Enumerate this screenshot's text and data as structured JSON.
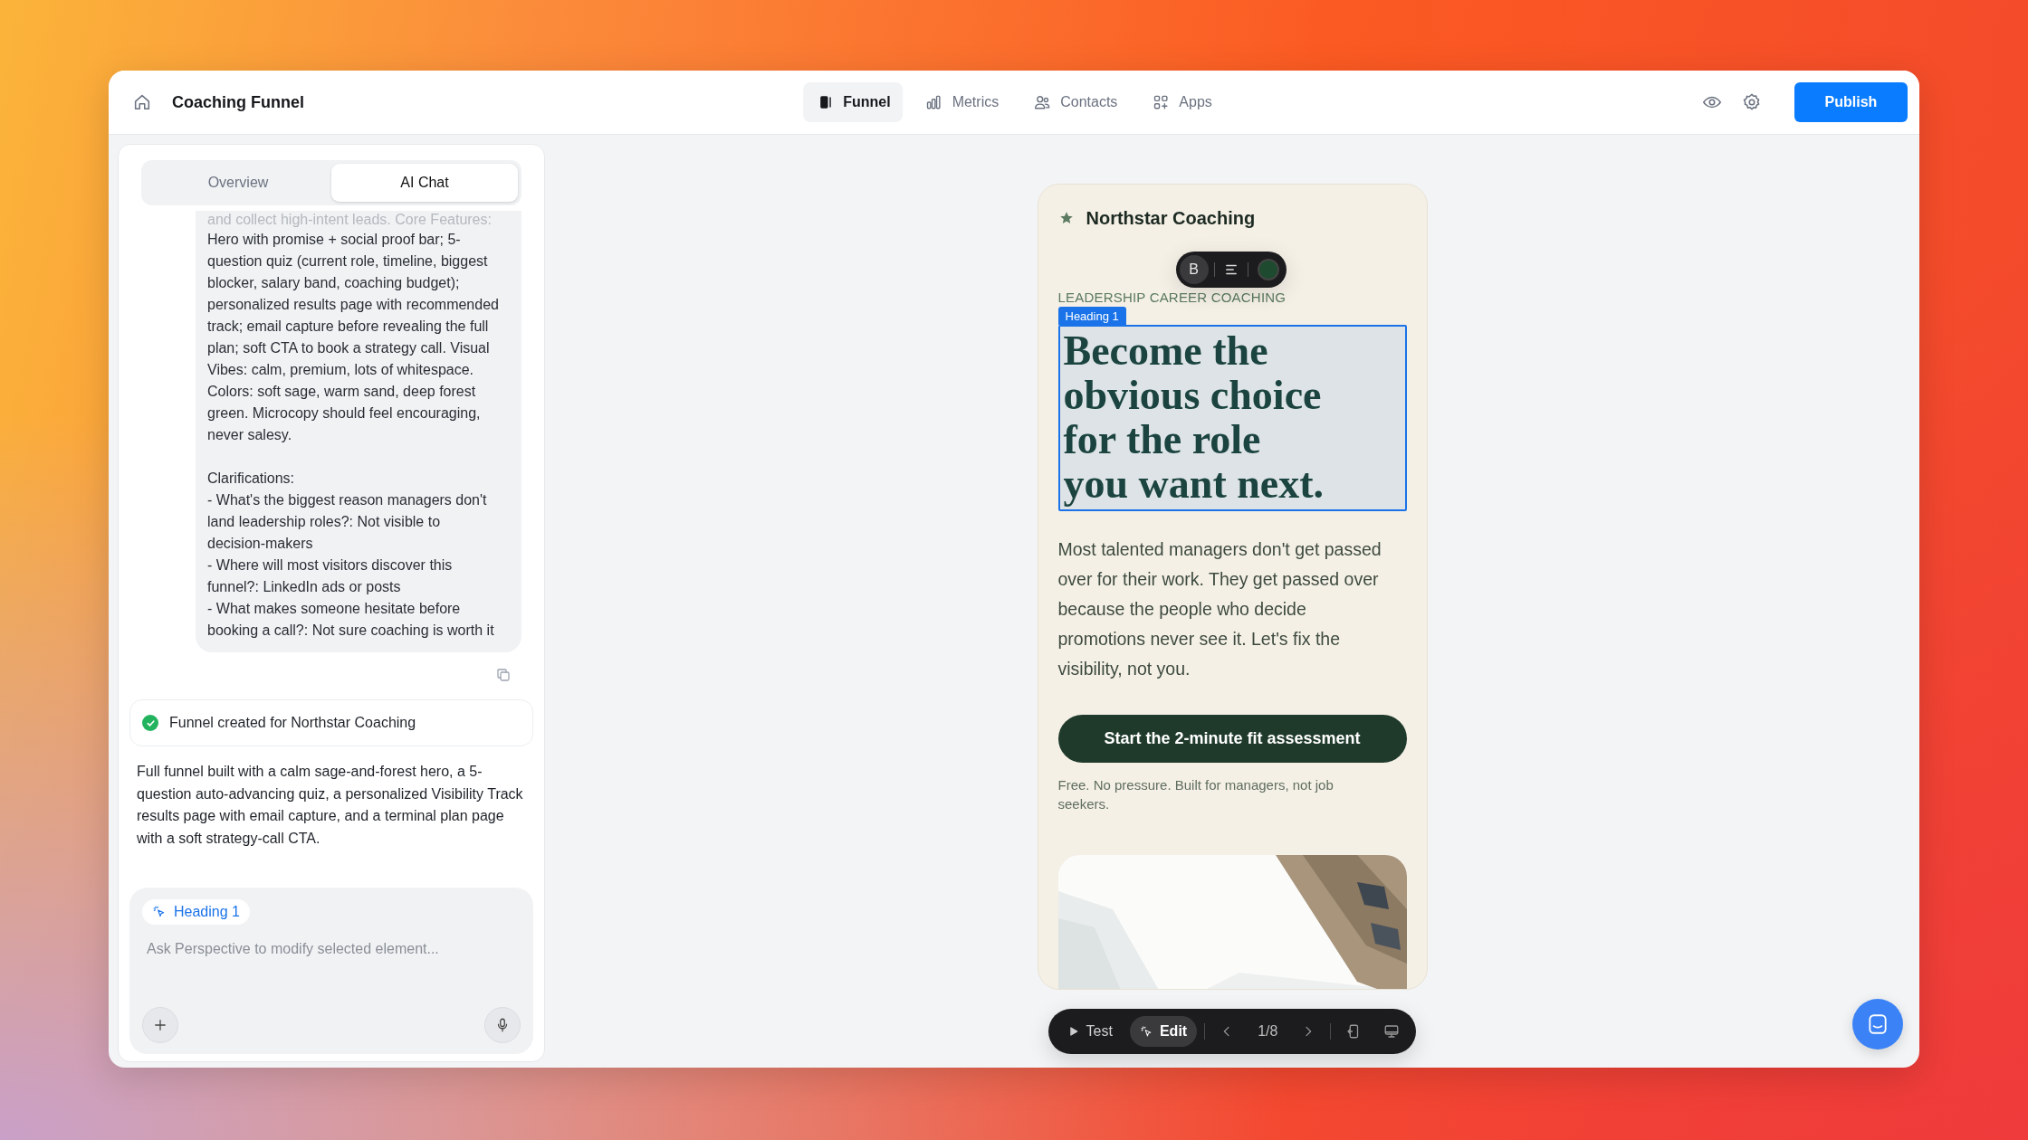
{
  "topbar": {
    "title": "Coaching Funnel",
    "nav": [
      {
        "label": "Funnel",
        "selected": true
      },
      {
        "label": "Metrics",
        "selected": false
      },
      {
        "label": "Contacts",
        "selected": false
      },
      {
        "label": "Apps",
        "selected": false
      }
    ],
    "publish": "Publish"
  },
  "panel": {
    "tabs": [
      {
        "label": "Overview",
        "selected": false
      },
      {
        "label": "AI Chat",
        "selected": true
      }
    ],
    "user_message": {
      "cut_line": "and collect high-intent leads. Core Features:",
      "text": "Hero with promise + social proof bar; 5-question quiz (current role, timeline, biggest blocker, salary band, coaching budget); personalized results page with recommended track; email capture before revealing the full plan; soft CTA to book a strategy call. Visual Vibes: calm, premium, lots of whitespace. Colors: soft sage, warm sand, deep forest green. Microcopy should feel encouraging, never salesy.\n\nClarifications:\n- What's the biggest reason managers don't land leadership roles?: Not visible to decision-makers\n- Where will most visitors discover this funnel?: LinkedIn ads or posts\n- What makes someone hesitate before booking a call?: Not sure coaching is worth it"
    },
    "status": {
      "text": "Funnel created for Northstar Coaching",
      "done": true
    },
    "summary": "Full funnel built with a calm sage-and-forest hero, a 5-question auto-advancing quiz, a personalized Visibility Track results page with email capture, and a terminal plan page with a soft strategy-call CTA.",
    "composer": {
      "chip": "Heading 1",
      "placeholder": "Ask Perspective to modify selected element..."
    }
  },
  "preview": {
    "brand": "Northstar Coaching",
    "format_bar": {
      "bold_label": "B",
      "bold": true,
      "color": "#1e4a2f"
    },
    "eyebrow": "LEADERSHIP CAREER COACHING",
    "selection_tag": "Heading 1",
    "heading": "Become the\nobvious choice\nfor the role\nyou want next.",
    "body": "Most talented managers don't get passed over for their work. They get passed over because the people who decide promotions never see it. Let's fix the visibility, not you.",
    "cta": "Start the 2-minute fit assessment",
    "note": "Free. No pressure. Built for managers, not job seekers."
  },
  "toolbar": {
    "modes": [
      {
        "label": "Test",
        "selected": false
      },
      {
        "label": "Edit",
        "selected": true
      }
    ],
    "page": "1/8"
  }
}
